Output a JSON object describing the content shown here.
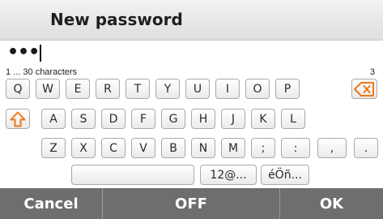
{
  "header": {
    "title": "New password"
  },
  "password": {
    "masked_value": "•••",
    "hint": "1 ... 30 characters",
    "count": "3"
  },
  "keyboard": {
    "row1": [
      "Q",
      "W",
      "E",
      "R",
      "T",
      "Y",
      "U",
      "I",
      "O",
      "P"
    ],
    "row2": [
      "A",
      "S",
      "D",
      "F",
      "G",
      "H",
      "J",
      "K",
      "L"
    ],
    "row3": [
      "Z",
      "X",
      "C",
      "V",
      "B",
      "N",
      "M",
      ";",
      ":",
      ",",
      "."
    ],
    "row4": {
      "symbols_label": "12@...",
      "accents_label": "éÖñ..."
    },
    "icons": {
      "backspace": "backspace-icon",
      "shift": "shift-icon"
    }
  },
  "footer": {
    "cancel_label": "Cancel",
    "off_label": "OFF",
    "ok_label": "OK"
  },
  "colors": {
    "accent": "#f07818",
    "footer_bg": "#6e6e6e"
  }
}
